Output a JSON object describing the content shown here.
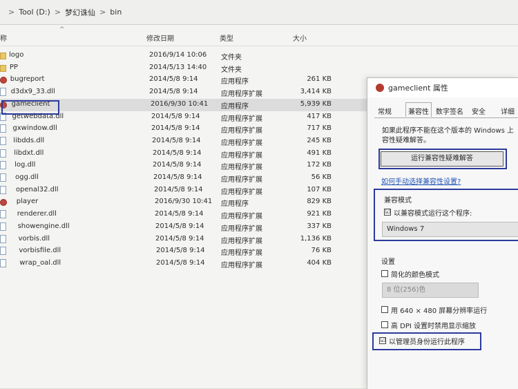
{
  "address": {
    "crumbs": [
      "Tool (D:)",
      "梦幻诛仙",
      "bin"
    ],
    "separators": [
      ">",
      ">",
      ">"
    ]
  },
  "columns": {
    "name": "称",
    "date": "修改日期",
    "type": "类型",
    "size": "大小"
  },
  "files": [
    {
      "name": "logo",
      "date": "2016/9/14 10:06",
      "type": "文件夹",
      "size": "",
      "icon": "folder-icon"
    },
    {
      "name": "PP",
      "date": "2014/5/13 14:40",
      "type": "文件夹",
      "size": "",
      "icon": "folder-icon"
    },
    {
      "name": "bugreport",
      "date": "2014/5/8 9:14",
      "type": "应用程序",
      "size": "261 KB",
      "icon": "app-icon"
    },
    {
      "name": "d3dx9_33.dll",
      "date": "2014/5/8 9:14",
      "type": "应用程序扩展",
      "size": "3,414 KB",
      "icon": "dll-icon"
    },
    {
      "name": "gameclient",
      "date": "2016/9/30 10:41",
      "type": "应用程序",
      "size": "5,939 KB",
      "icon": "app-icon"
    },
    {
      "name": "getwebdata.dll",
      "date": "2014/5/8 9:14",
      "type": "应用程序扩展",
      "size": "417 KB",
      "icon": "dll-icon"
    },
    {
      "name": "gxwindow.dll",
      "date": "2014/5/8 9:14",
      "type": "应用程序扩展",
      "size": "717 KB",
      "icon": "dll-icon"
    },
    {
      "name": "libdds.dll",
      "date": "2014/5/8 9:14",
      "type": "应用程序扩展",
      "size": "245 KB",
      "icon": "dll-icon"
    },
    {
      "name": "libdxt.dll",
      "date": "2014/5/8 9:14",
      "type": "应用程序扩展",
      "size": "491 KB",
      "icon": "dll-icon"
    },
    {
      "name": "log.dll",
      "date": "2014/5/8 9:14",
      "type": "应用程序扩展",
      "size": "172 KB",
      "icon": "dll-icon"
    },
    {
      "name": "ogg.dll",
      "date": "2014/5/8 9:14",
      "type": "应用程序扩展",
      "size": "56 KB",
      "icon": "dll-icon"
    },
    {
      "name": "openal32.dll",
      "date": "2014/5/8 9:14",
      "type": "应用程序扩展",
      "size": "107 KB",
      "icon": "dll-icon"
    },
    {
      "name": "player",
      "date": "2016/9/30 10:41",
      "type": "应用程序",
      "size": "829 KB",
      "icon": "app-icon"
    },
    {
      "name": "renderer.dll",
      "date": "2014/5/8 9:14",
      "type": "应用程序扩展",
      "size": "921 KB",
      "icon": "dll-icon"
    },
    {
      "name": "showengine.dll",
      "date": "2014/5/8 9:14",
      "type": "应用程序扩展",
      "size": "337 KB",
      "icon": "dll-icon"
    },
    {
      "name": "vorbis.dll",
      "date": "2014/5/8 9:14",
      "type": "应用程序扩展",
      "size": "1,136 KB",
      "icon": "dll-icon"
    },
    {
      "name": "vorbisfile.dll",
      "date": "2014/5/8 9:14",
      "type": "应用程序扩展",
      "size": "76 KB",
      "icon": "dll-icon"
    },
    {
      "name": "wrap_oal.dll",
      "date": "2014/5/8 9:14",
      "type": "应用程序扩展",
      "size": "404 KB",
      "icon": "dll-icon"
    }
  ],
  "selected_index": 4,
  "dialog": {
    "title": "gameclient 属性",
    "tabs": [
      "常规",
      "兼容性",
      "数字签名",
      "安全",
      "详细"
    ],
    "active_tab": 1,
    "description_line1": "如果此程序不能在这个版本的 Windows 上",
    "description_line2": "容性疑难解答。",
    "troubleshoot_button": "运行兼容性疑难解答",
    "manual_link": "如何手动选择兼容性设置?",
    "compat_group": "兼容模式",
    "compat_checkbox": "以兼容模式运行这个程序:",
    "compat_checked": "☑",
    "compat_os": "Windows 7",
    "settings_group": "设置",
    "reduced_color": "简化的颜色模式",
    "color_depth": "8 位(256)色",
    "res_640": "用 640 × 480 屏幕分辨率运行",
    "dpi": "高 DPI 设置时禁用显示缩放",
    "admin": "以管理员身份运行此程序",
    "admin_checked": "☑"
  },
  "colors": {
    "highlight_box": "#2b3a9c",
    "link": "#2155b6",
    "selected_row": "#dcdcdc"
  }
}
